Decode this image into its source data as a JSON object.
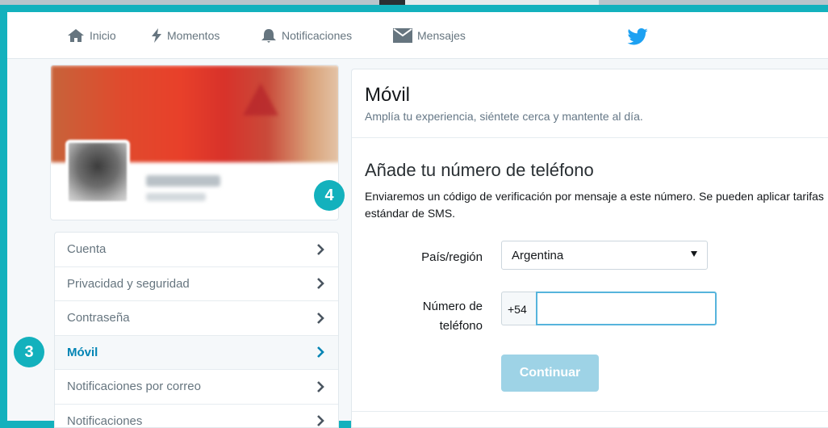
{
  "nav": {
    "home": "Inicio",
    "moments": "Momentos",
    "notifications": "Notificaciones",
    "messages": "Mensajes"
  },
  "sidebar": {
    "items": [
      {
        "label": "Cuenta",
        "active": false
      },
      {
        "label": "Privacidad y seguridad",
        "active": false
      },
      {
        "label": "Contraseña",
        "active": false
      },
      {
        "label": "Móvil",
        "active": true
      },
      {
        "label": "Notificaciones por correo",
        "active": false
      },
      {
        "label": "Notificaciones",
        "active": false
      }
    ]
  },
  "main": {
    "title": "Móvil",
    "subtitle": "Amplía tu experiencia, siéntete cerca y mantente al día.",
    "section_title": "Añade tu número de teléfono",
    "section_desc": "Enviaremos un código de verificación por mensaje a este número. Se pueden aplicar tarifas estándar de SMS.",
    "country_label": "País/región",
    "country_value": "Argentina",
    "phone_label": "Número de teléfono",
    "phone_prefix": "+54",
    "phone_value": "",
    "continue_label": "Continuar"
  },
  "annotations": {
    "step_3": "3",
    "step_4": "4"
  },
  "colors": {
    "accent": "#13b1bd",
    "link_active": "#0084b4",
    "twitter_blue": "#1da1f2",
    "button_disabled": "#9ed3e6"
  },
  "icons": [
    "home-icon",
    "lightning-icon",
    "bell-icon",
    "envelope-icon",
    "twitter-bird-icon",
    "chevron-right-icon"
  ]
}
